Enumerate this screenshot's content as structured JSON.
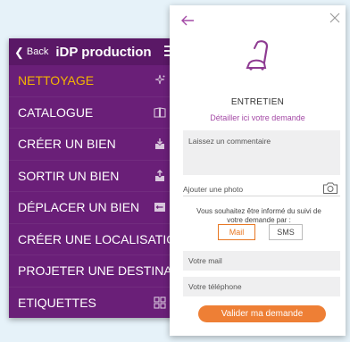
{
  "menu": {
    "back_label": "Back",
    "title": "iDP production",
    "items": [
      {
        "label": "NETTOYAGE",
        "active": true,
        "icon": "sparkle-icon"
      },
      {
        "label": "CATALOGUE",
        "active": false,
        "icon": "book-icon"
      },
      {
        "label": "CRÉER UN BIEN",
        "active": false,
        "icon": "box-in-icon"
      },
      {
        "label": "SORTIR UN BIEN",
        "active": false,
        "icon": "box-out-icon"
      },
      {
        "label": "DÉPLACER UN BIEN",
        "active": false,
        "icon": "move-icon"
      },
      {
        "label": "CRÉER UNE LOCALISATIO",
        "active": false,
        "icon": ""
      },
      {
        "label": "PROJETER UNE DESTINAT",
        "active": false,
        "icon": ""
      },
      {
        "label": "ETIQUETTES",
        "active": false,
        "icon": "grid-icon"
      }
    ]
  },
  "form": {
    "heading": "ENTRETIEN",
    "subheading": "Détailler ici votre demande",
    "comment_placeholder": "Laissez un commentaire",
    "photo_label": "Ajouter une photo",
    "notify_text": "Vous souhaitez être informé du suivi de votre demande par :",
    "mail_button": "Mail",
    "sms_button": "SMS",
    "mail_placeholder": "Votre mail",
    "phone_placeholder": "Votre téléphone",
    "submit_label": "Valider ma demande"
  },
  "colors": {
    "menu_bg": "#6a1f78",
    "active_item": "#f4b400",
    "accent_orange": "#ee7f35",
    "accent_purple": "#a44aa6"
  }
}
